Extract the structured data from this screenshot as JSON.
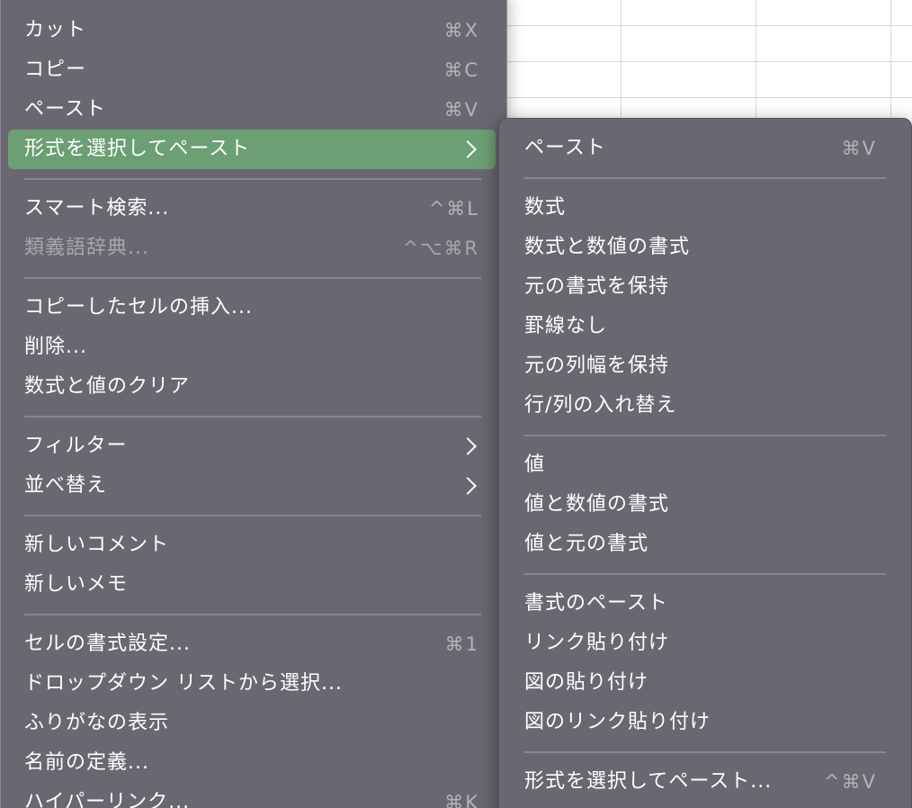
{
  "main_menu": {
    "groups": [
      [
        {
          "label": "カット",
          "shortcut": "⌘X"
        },
        {
          "label": "コピー",
          "shortcut": "⌘C"
        },
        {
          "label": "ペースト",
          "shortcut": "⌘V"
        },
        {
          "label": "形式を選択してペースト",
          "submenu": true,
          "highlighted": true
        }
      ],
      [
        {
          "label": "スマート検索...",
          "shortcut": "^⌘L"
        },
        {
          "label": "類義語辞典...",
          "shortcut": "^⌥⌘R",
          "disabled": true
        }
      ],
      [
        {
          "label": "コピーしたセルの挿入..."
        },
        {
          "label": "削除..."
        },
        {
          "label": "数式と値のクリア"
        }
      ],
      [
        {
          "label": "フィルター",
          "submenu": true
        },
        {
          "label": "並べ替え",
          "submenu": true
        }
      ],
      [
        {
          "label": "新しいコメント"
        },
        {
          "label": "新しいメモ"
        }
      ],
      [
        {
          "label": "セルの書式設定...",
          "shortcut": "⌘1"
        },
        {
          "label": "ドロップダウン リストから選択..."
        },
        {
          "label": "ふりがなの表示"
        },
        {
          "label": "名前の定義..."
        },
        {
          "label": "ハイパーリンク...",
          "shortcut": "⌘K"
        }
      ]
    ]
  },
  "paste_special_submenu": {
    "groups": [
      [
        {
          "label": "ペースト",
          "shortcut": "⌘V"
        }
      ],
      [
        {
          "label": "数式"
        },
        {
          "label": "数式と数値の書式"
        },
        {
          "label": "元の書式を保持"
        },
        {
          "label": "罫線なし"
        },
        {
          "label": "元の列幅を保持"
        },
        {
          "label": "行/列の入れ替え"
        }
      ],
      [
        {
          "label": "値"
        },
        {
          "label": "値と数値の書式"
        },
        {
          "label": "値と元の書式"
        }
      ],
      [
        {
          "label": "書式のペースト"
        },
        {
          "label": "リンク貼り付け"
        },
        {
          "label": "図の貼り付け"
        },
        {
          "label": "図のリンク貼り付け"
        }
      ],
      [
        {
          "label": "形式を選択してペースト...",
          "shortcut": "^⌘V"
        }
      ]
    ]
  },
  "colors": {
    "menu_background": "#6b6770",
    "highlight": "#6c9f74",
    "separator": "#8a868d",
    "shortcut_text": "#b6b2b9"
  }
}
